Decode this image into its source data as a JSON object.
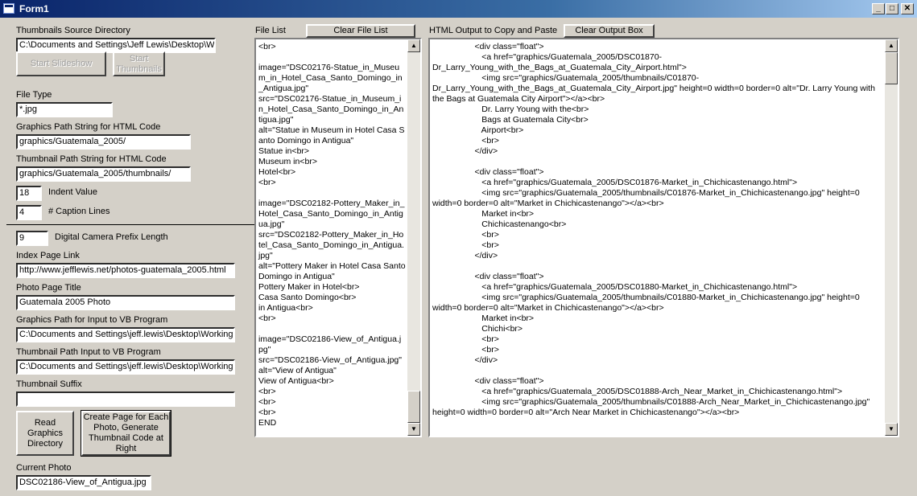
{
  "window": {
    "title": "Form1",
    "min": "_",
    "max": "□",
    "close": "✕"
  },
  "left": {
    "thumb_src_label": "Thumbnails Source Directory",
    "thumb_src_value": "C:\\Documents and Settings\\Jeff Lewis\\Desktop\\W",
    "start_slideshow": "Start Slideshow",
    "start_thumbnails": "Start Thumbnails",
    "file_type_label": "File Type",
    "file_type_value": "*.jpg",
    "graphics_path_label": "Graphics Path String for HTML Code",
    "graphics_path_value": "graphics/Guatemala_2005/",
    "thumb_path_label": "Thumbnail Path String for HTML Code",
    "thumb_path_value": "graphics/Guatemala_2005/thumbnails/",
    "indent_value": "18",
    "indent_label": "Indent Value",
    "caption_value": "4",
    "caption_label": "# Caption Lines",
    "prefix_value": "9",
    "prefix_label": "Digital Camera Prefix Length",
    "index_link_label": "Index Page Link",
    "index_link_value": "http://www.jefflewis.net/photos-guatemala_2005.html",
    "photo_title_label": "Photo Page Title",
    "photo_title_value": "Guatemala 2005 Photo",
    "graphics_vb_label": "Graphics Path for Input to VB Program",
    "graphics_vb_value": "C:\\Documents and Settings\\jeff.lewis\\Desktop\\Working",
    "thumb_vb_label": "Thumbnail Path Input to VB Program",
    "thumb_vb_value": "C:\\Documents and Settings\\jeff.lewis\\Desktop\\Working",
    "thumb_suffix_label": "Thumbnail Suffix",
    "thumb_suffix_value": "",
    "read_dir_btn": "Read Graphics Directory",
    "create_page_btn": "Create Page for Each Photo, Generate Thumbnail Code at Right",
    "current_photo_label": "Current Photo",
    "current_photo_value": "DSC02186-View_of_Antigua.jpg"
  },
  "file_list": {
    "label": "File List",
    "clear_btn": "Clear File List",
    "text": "<br>\n\nimage=\"DSC02176-Statue_in_Museum_in_Hotel_Casa_Santo_Domingo_in_Antigua.jpg\"\nsrc=\"DSC02176-Statue_in_Museum_in_Hotel_Casa_Santo_Domingo_in_Antigua.jpg\"\nalt=\"Statue in Museum in Hotel Casa Santo Domingo in Antigua\"\nStatue in<br>\nMuseum in<br>\nHotel<br>\n<br>\n\nimage=\"DSC02182-Pottery_Maker_in_Hotel_Casa_Santo_Domingo_in_Antigua.jpg\"\nsrc=\"DSC02182-Pottery_Maker_in_Hotel_Casa_Santo_Domingo_in_Antigua.jpg\"\nalt=\"Pottery Maker in Hotel Casa Santo Domingo in Antigua\"\nPottery Maker in Hotel<br>\nCasa Santo Domingo<br>\nin Antigua<br>\n<br>\n\nimage=\"DSC02186-View_of_Antigua.jpg\"\nsrc=\"DSC02186-View_of_Antigua.jpg\"\nalt=\"View of Antigua\"\nView of Antigua<br>\n<br>\n<br>\n<br>\nEND"
  },
  "output": {
    "label": "HTML Output to Copy and Paste",
    "clear_btn": "Clear Output Box",
    "lines": [
      "                  <div class=\"float\">",
      "                     <a href=\"graphics/Guatemala_2005/DSC01870-",
      "Dr_Larry_Young_with_the_Bags_at_Guatemala_City_Airport.html\">",
      "                     <img src=\"graphics/Guatemala_2005/thumbnails/C01870-",
      "Dr_Larry_Young_with_the_Bags_at_Guatemala_City_Airport.jpg\" height=0 width=0 border=0 alt=\"Dr. Larry Young with",
      "the Bags at Guatemala City Airport\"></a><br>",
      "                     Dr. Larry Young with the<br>",
      "                     Bags at Guatemala City<br>",
      "                     Airport<br>",
      "                     <br>",
      "                  </div>",
      "",
      "                  <div class=\"float\">",
      "                     <a href=\"graphics/Guatemala_2005/DSC01876-Market_in_Chichicastenango.html\">",
      "                     <img src=\"graphics/Guatemala_2005/thumbnails/C01876-Market_in_Chichicastenango.jpg\" height=0",
      "width=0 border=0 alt=\"Market in Chichicastenango\"></a><br>",
      "                     Market in<br>",
      "                     Chichicastenango<br>",
      "                     <br>",
      "                     <br>",
      "                  </div>",
      "",
      "                  <div class=\"float\">",
      "                     <a href=\"graphics/Guatemala_2005/DSC01880-Market_in_Chichicastenango.html\">",
      "                     <img src=\"graphics/Guatemala_2005/thumbnails/C01880-Market_in_Chichicastenango.jpg\" height=0",
      "width=0 border=0 alt=\"Market in Chichicastenango\"></a><br>",
      "                     Market in<br>",
      "                     Chichi<br>",
      "                     <br>",
      "                     <br>",
      "                  </div>",
      "",
      "                  <div class=\"float\">",
      "                     <a href=\"graphics/Guatemala_2005/DSC01888-Arch_Near_Market_in_Chichicastenango.html\">",
      "                     <img src=\"graphics/Guatemala_2005/thumbnails/C01888-Arch_Near_Market_in_Chichicastenango.jpg\"",
      "height=0 width=0 border=0 alt=\"Arch Near Market in Chichicastenango\"></a><br>"
    ]
  }
}
